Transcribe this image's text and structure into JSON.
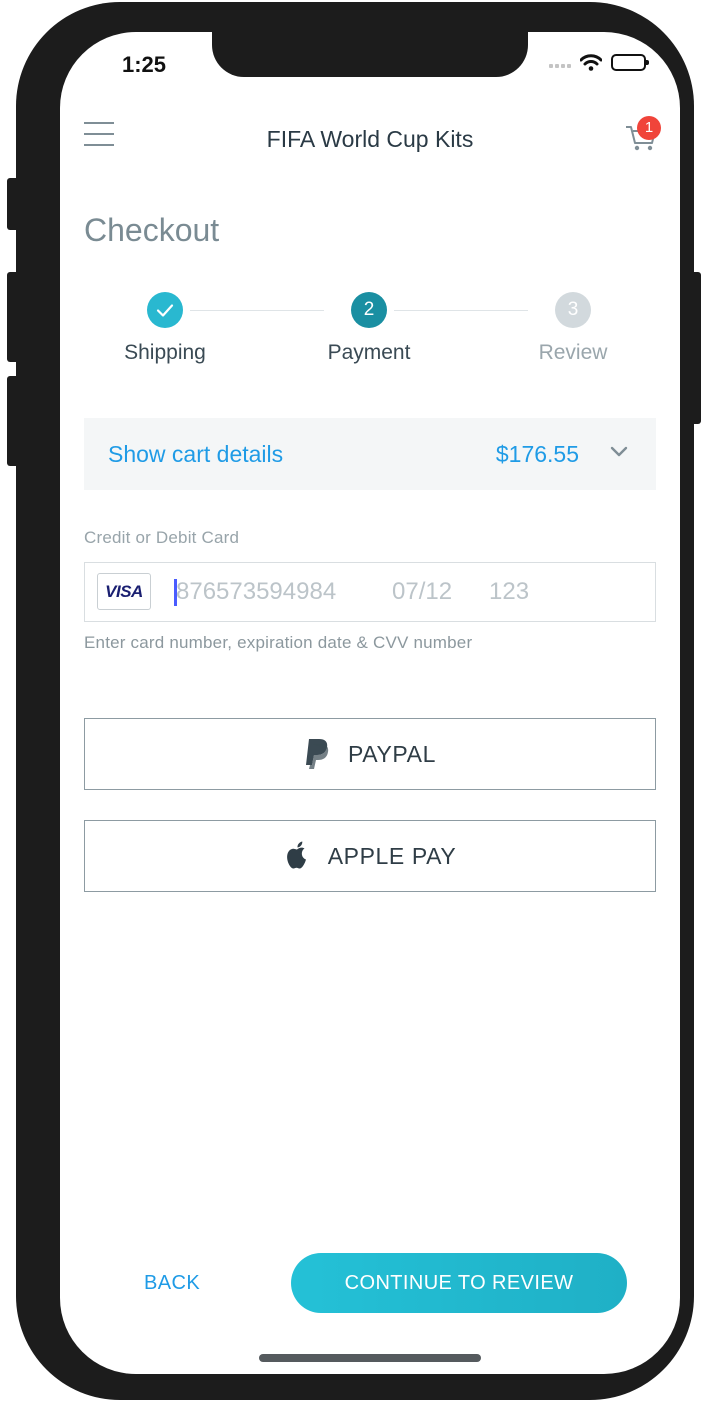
{
  "status_bar": {
    "time": "1:25"
  },
  "header": {
    "title": "FIFA World Cup Kits",
    "cart_count": "1"
  },
  "page": {
    "title": "Checkout"
  },
  "stepper": {
    "steps": [
      {
        "label": "Shipping",
        "number": "1",
        "state": "completed"
      },
      {
        "label": "Payment",
        "number": "2",
        "state": "active"
      },
      {
        "label": "Review",
        "number": "3",
        "state": "upcoming"
      }
    ]
  },
  "cart_summary": {
    "label": "Show cart details",
    "total": "$176.55"
  },
  "card": {
    "label": "Credit or Debit Card",
    "brand": "VISA",
    "number_placeholder": "876573594984",
    "expiry_placeholder": "07/12",
    "cvv_placeholder": "123",
    "hint": "Enter card number, expiration date & CVV number"
  },
  "alt_payments": {
    "paypal_label": "PAYPAL",
    "applepay_label": "APPLE PAY"
  },
  "footer": {
    "back_label": "BACK",
    "continue_label": "CONTINUE TO REVIEW"
  },
  "colors": {
    "accent": "#1f9be6",
    "step_completed": "#29b8d0",
    "step_active": "#1a8fa2",
    "step_upcoming": "#d2d9dd",
    "badge": "#f0443a",
    "primary_button": "#24c1d7"
  }
}
